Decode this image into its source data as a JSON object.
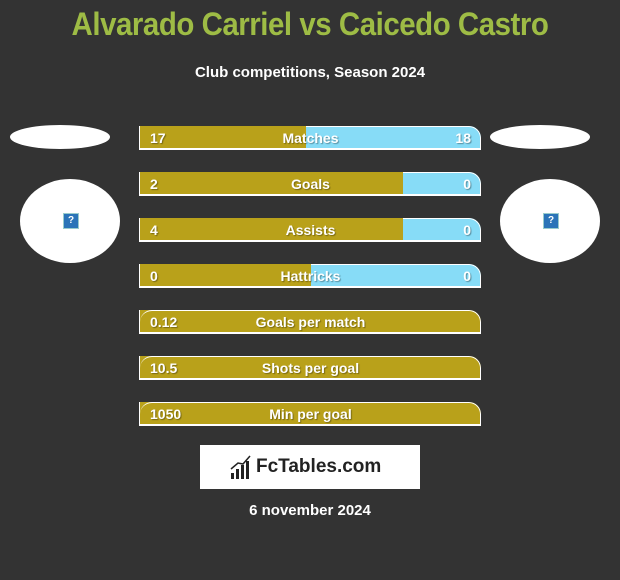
{
  "header": {
    "title": "Alvarado Carriel vs Caicedo Castro",
    "subtitle": "Club competitions, Season 2024"
  },
  "players": {
    "left": {
      "avatar_icon": "question-icon"
    },
    "right": {
      "avatar_icon": "question-icon"
    }
  },
  "colors": {
    "left": "#b9a11a",
    "right": "#87dcf7",
    "title": "#9ebc45",
    "background": "#333333"
  },
  "stats": [
    {
      "label": "Matches",
      "left": "17",
      "right": "18",
      "left_share": 0.486
    },
    {
      "label": "Goals",
      "left": "2",
      "right": "0",
      "left_share": 0.77
    },
    {
      "label": "Assists",
      "left": "4",
      "right": "0",
      "left_share": 0.77
    },
    {
      "label": "Hattricks",
      "left": "0",
      "right": "0",
      "left_share": 0.5
    },
    {
      "label": "Goals per match",
      "left": "0.12",
      "right": null,
      "left_share": 1
    },
    {
      "label": "Shots per goal",
      "left": "10.5",
      "right": null,
      "left_share": 1
    },
    {
      "label": "Min per goal",
      "left": "1050",
      "right": null,
      "left_share": 1
    }
  ],
  "logo": {
    "text": "FcTables.com",
    "icon": "bar-chart-icon"
  },
  "date": "6 november 2024"
}
